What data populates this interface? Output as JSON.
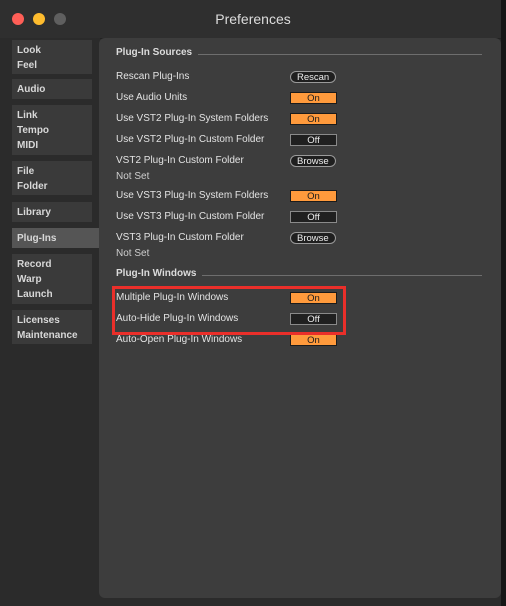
{
  "window": {
    "title": "Preferences"
  },
  "sidebar": {
    "items": [
      {
        "lines": [
          "Look",
          "Feel"
        ]
      },
      {
        "lines": [
          "Audio"
        ]
      },
      {
        "lines": [
          "Link",
          "Tempo",
          "MIDI"
        ]
      },
      {
        "lines": [
          "File",
          "Folder"
        ]
      },
      {
        "lines": [
          "Library"
        ]
      },
      {
        "lines": [
          "Plug-Ins"
        ],
        "selected": true
      },
      {
        "lines": [
          "Record",
          "Warp",
          "Launch"
        ]
      },
      {
        "lines": [
          "Licenses",
          "Maintenance"
        ]
      }
    ]
  },
  "sections": {
    "plugin_sources": {
      "title": "Plug-In Sources",
      "rescan": {
        "label": "Rescan Plug-Ins",
        "button": "Rescan"
      },
      "use_audio_units": {
        "label": "Use Audio Units",
        "value": "On"
      },
      "vst2_system": {
        "label": "Use VST2 Plug-In System Folders",
        "value": "On"
      },
      "vst2_custom": {
        "label": "Use VST2 Plug-In Custom Folder",
        "value": "Off"
      },
      "vst2_folder": {
        "label": "VST2 Plug-In Custom Folder",
        "button": "Browse",
        "status": "Not Set"
      },
      "vst3_system": {
        "label": "Use VST3 Plug-In System Folders",
        "value": "On"
      },
      "vst3_custom": {
        "label": "Use VST3 Plug-In Custom Folder",
        "value": "Off"
      },
      "vst3_folder": {
        "label": "VST3 Plug-In Custom Folder",
        "button": "Browse",
        "status": "Not Set"
      }
    },
    "plugin_windows": {
      "title": "Plug-In Windows",
      "multiple": {
        "label": "Multiple Plug-In Windows",
        "value": "On"
      },
      "auto_hide": {
        "label": "Auto-Hide Plug-In Windows",
        "value": "Off"
      },
      "auto_open": {
        "label": "Auto-Open Plug-In Windows",
        "value": "On"
      }
    }
  },
  "colors": {
    "toggle_on": "#ff9a3c",
    "highlight": "#ea2f2a"
  }
}
